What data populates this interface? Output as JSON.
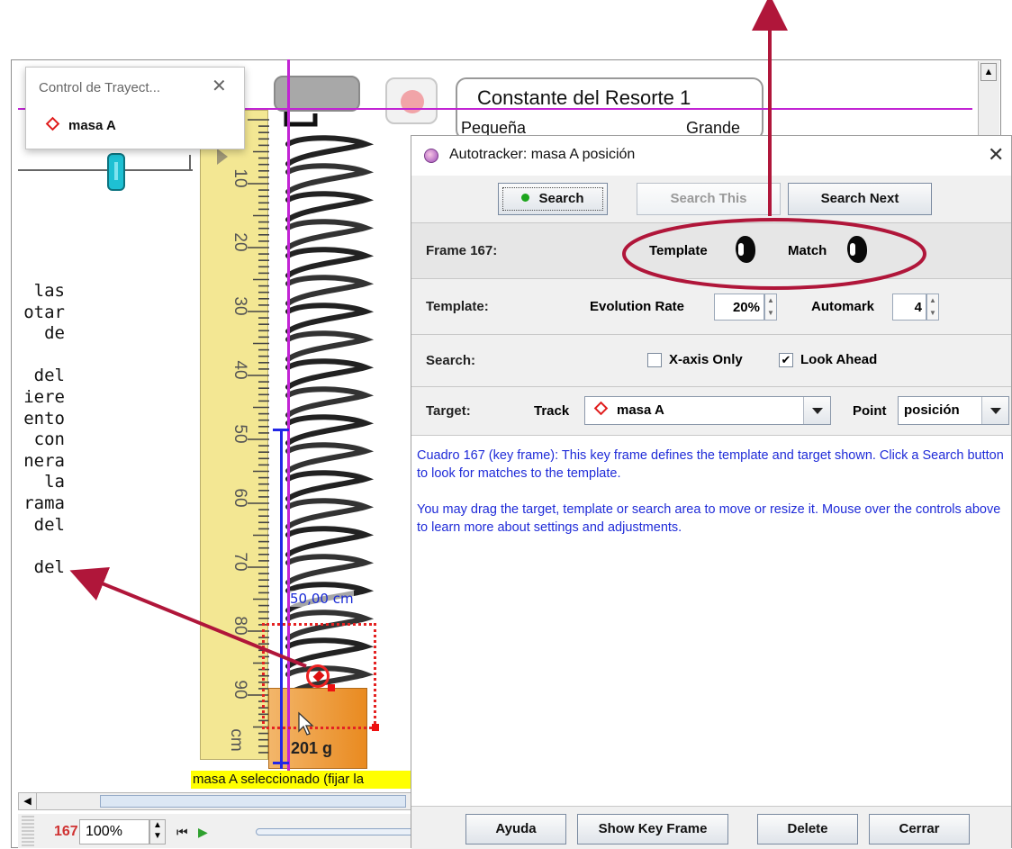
{
  "background_app": {
    "trajectory_window": {
      "title": "Control de Trayect...",
      "close_glyph": "✕",
      "item_label": "masa A"
    },
    "spring_control": {
      "title": "Constante del Resorte 1",
      "small_label": "Pequeña",
      "large_label": "Grande"
    },
    "ruler": {
      "numbers": [
        "10",
        "20",
        "30",
        "40",
        "50",
        "60",
        "70",
        "80",
        "90"
      ],
      "unit": "cm"
    },
    "dimension_label": "50,00 cm",
    "mass_label": "201 g",
    "left_text_fragments": [
      "las",
      "otar",
      "de",
      "",
      "del",
      "iere",
      "ento",
      "con",
      "nera",
      "la",
      "rama",
      "del",
      "",
      "del"
    ],
    "status_text": "masa A seleccionado (fijar la",
    "frame_number": "167",
    "zoom_value": "100%"
  },
  "autotracker": {
    "title": "Autotracker: masa A posición",
    "close_glyph": "✕",
    "buttons": {
      "search": "Search",
      "search_this": "Search This",
      "search_next": "Search Next"
    },
    "frame_row": {
      "label": "Frame 167:",
      "template_label": "Template",
      "match_label": "Match"
    },
    "template_row": {
      "label": "Template:",
      "evolution_label": "Evolution Rate",
      "evolution_value": "20%",
      "automark_label": "Automark",
      "automark_value": "4"
    },
    "search_row": {
      "label": "Search:",
      "xaxis_label": "X-axis Only",
      "xaxis_checked": false,
      "lookahead_label": "Look Ahead",
      "lookahead_checked": true,
      "check_glyph": "✔"
    },
    "target_row": {
      "label": "Target:",
      "track_label": "Track",
      "track_value": "masa A",
      "point_label": "Point",
      "point_value": "posición"
    },
    "info": {
      "paragraph1": "Cuadro 167 (key frame): This key frame defines the template and target shown. Click a Search button to look for matches to the template.",
      "paragraph2": "You may drag the target, template or search area to move or resize it.  Mouse over the controls above to learn more about settings and adjustments."
    },
    "footer": {
      "help": "Ayuda",
      "show_key_frame": "Show Key Frame",
      "delete": "Delete",
      "close": "Cerrar"
    }
  },
  "colors": {
    "annotation_red": "#b0163a",
    "trail_magenta": "#c224d4",
    "axis_blue": "#2227e6",
    "info_blue": "#1f2bd8"
  }
}
